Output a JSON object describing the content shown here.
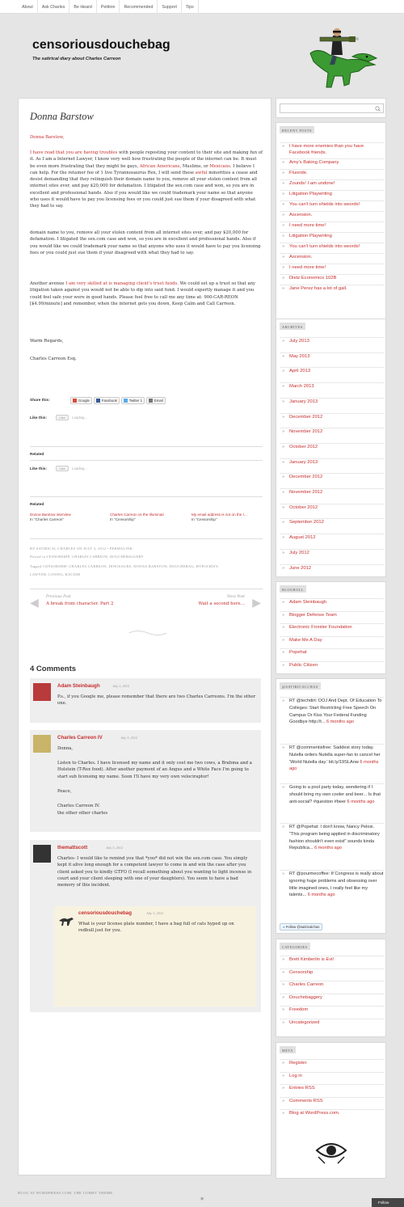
{
  "nav": [
    "About",
    "Ask Charles",
    "Be Heard",
    "Petition",
    "Recommended",
    "Support",
    "Tips"
  ],
  "site": {
    "title": "censoriousdouchebag",
    "tagline": "The satirical diary about Charles Carreon"
  },
  "post": {
    "title": "Donna Barstow",
    "salutation": "Donna Barstow,",
    "p1_link": "I have read that you are having troubles",
    "p1_a": " with people reposting your content to their site and making fun of it. As I am a Internet Lawyer, I know very well how frustrating the people of the internet can be. It must be even more frustrating that they might be gays, ",
    "p1_aa": "African Americans",
    "p1_b": ", Muslims, or ",
    "p1_mex": "Mexicans",
    "p1_c": ". I believe I can help. For the retainer fee of 1 live Tyrannosaurus Rex, I will send these ",
    "p1_awful": "awful",
    "p1_d": " minorities a cease and desist demanding that they relinquish their domain name to you, remove all your stolen content from all internet sites ever, and pay $20,000 for defamation. I litigated the sex.com case and won, so you are in excellent and professional hands. Also if you would like we could trademark your name so that anyone who uses it would have to pay you licensing fees or you could just sue them if your disagreed with what they had to say.",
    "p2": "domain name to you, remove all your stolen content from all internet sites ever, and pay $20,000 for defamation. I litigated the sex.com case and won, so you are in excellent and professional hands. Also if you would like we could trademark your name so that anyone who uses it would have to pay you licensing fees or you could just sue them if your disagreed with what they had to say.",
    "p3_a": "Another avenue ",
    "p3_link": "I am very skilled at is managing client's trust funds",
    "p3_b": ". We could set up a trust so that any litigation taken against you would not be able to dip into said fund. I would expertly manage it and you could feel safe your were in good hands. Please feel free to call me any time at: 900-CAR-REON [$4.99/minute] and remember, when the internet gets you down, Keep Calm and Call Carreon.",
    "regards": "Warm Regards,",
    "sign": "Charles Carreon Esq."
  },
  "share": {
    "label": "Share this:",
    "buttons": [
      "Google",
      "Facebook",
      "Twitter",
      "Email"
    ],
    "twitter_count": "1"
  },
  "like": {
    "label": "Like this:",
    "button": "Like",
    "loading": "Loading..."
  },
  "related": {
    "label": "Related",
    "items": [
      {
        "title": "Donna Barstow interview",
        "cat": "In \"Charles Carreon\""
      },
      {
        "title": "Charles Carreon vs the Illuminati",
        "cat": "In \"Censorship\""
      },
      {
        "title": "My email address is not on the l…",
        "cat": "In \"Censorship\""
      }
    ]
  },
  "meta": {
    "line1": "BY SATIRICAL CHARLES ON JULY 3, 2012 • PERMALINK",
    "line2": "Posted in CENSORSHIP, CHARLES CARREON, DOUCHEBAGGERY",
    "line3": "Tagged CENSORSHIP, CHARLES CARREON, DINOSAURS, DONNA BARSTOW, DOUCHEBAG, HYPOCRISY,",
    "line4": "LAWYER, LOSING, RACISM"
  },
  "postnav": {
    "prev_label": "Previous Post",
    "prev_title": "A break from character. Part 2",
    "next_label": "Next Post",
    "next_title": "Wait a second here…"
  },
  "comments": {
    "title": "4 Comments",
    "list": [
      {
        "author": "Adam Steinbaugh",
        "date": "July 3, 2012",
        "text": "P.s., if you Google me, please remember that there are two Charles Carreons. I'm the other one."
      },
      {
        "author": "Charles Carreon IV",
        "date": "July 3, 2012",
        "t1": "Donna,",
        "t2": "Listen to Charles. I have licensed my name and it only cost me two cows, a Brahma and a Holstein (T-Rex food). After another payment of an Angus and a White Face I'm going to start sub licensing my name. Soon I'll have my very own velociraptor!",
        "t3": "Peace,",
        "t4": "Charles Carreon IV.",
        "t5": "the other other charles"
      },
      {
        "author": "themattscott",
        "date": "July 3, 2012",
        "text": "Charles- I would like to remind you that *you* did not win the sex.com case. You simply kept it alive long enough for a competent lawyer to come in and win the case after you client asked you to kindly GTFO (I recall something about you wanting to light incense in court and your client sleeping with one of your daughters). You seem to have a bad memory of this incident."
      },
      {
        "author": "censoriousdouchebag",
        "date": "July 3, 2012",
        "text": "What is your license plate number, I have a bag full of cats hyped up on redbull just for you."
      }
    ]
  },
  "sidebar": {
    "recent_title": "RECENT POSTS",
    "recent": [
      "I have more enemies than you have Facebook friends.",
      "Amy's Baking Company",
      "Fluoride.",
      "Zounds! I am undone!",
      "Litigation Playwriting",
      "You can't turn shields into swords!",
      "Ascension.",
      "I need more time!",
      "Litigation Playwriting",
      "You can't turn shields into swords!",
      "Ascension.",
      "I need more time!",
      "Dietz Economics 102B",
      "Jane Perez has a lot of gall."
    ],
    "archives_title": "ARCHIVES",
    "archives": [
      "July 2013",
      "May 2013",
      "April 2013",
      "March 2013",
      "January 2013",
      "December 2012",
      "November 2012",
      "October 2012",
      "January 2013",
      "December 2012",
      "November 2012",
      "October 2012",
      "September 2012",
      "August 2012",
      "July 2012",
      "June 2012"
    ],
    "blogroll_title": "BLOGROLL",
    "blogroll": [
      "Adam Steinbaugh",
      "Blogger Defense Team",
      "Electronic Frontier Foundation",
      "Make Me A Day",
      "Popehat",
      "Public Citizen"
    ],
    "twitter_title": "@SATIRICALCHAS",
    "tweets": [
      {
        "text": "RT @techdirt: DOJ And Dept. Of Education To Colleges: Start Restricting Free Speech On Campus Or Kiss Your Federal Funding Goodbye http://t...",
        "time": "6 months ago"
      },
      {
        "text": "RT @commentisfree: Saddest story today. Nutella orders Nutella super-fan to cancel her 'World Nutella day.' bit.ly/19SLAnw",
        "time": "6 months ago"
      },
      {
        "text": "Going to a pool party today, wondering if I should bring my own cooler and beer... Is that anti-social? #question #beer",
        "time": "6 months ago"
      },
      {
        "text": "RT @Popehat: I don't know, Nancy Pelosi. \"This program being applied in discriminatory fashion shouldn't even exist\" sounds kinda Republica...",
        "time": "6 months ago"
      },
      {
        "text": "RT @pourmecoffee: If Congress is really about ignoring huge problems and obsessing over little imagined ones, I really feel like my talents...",
        "time": "6 months ago"
      }
    ],
    "follow_twitter": "Follow @satiricalchas",
    "categories_title": "CATEGORIES",
    "categories": [
      "Brett Kimberlin is Evil",
      "Censorship",
      "Charles Carreon",
      "Douchebaggery",
      "Freedom",
      "Uncategorized"
    ],
    "meta_title": "META",
    "meta": [
      "Register",
      "Log in",
      "Entries RSS",
      "Comments RSS",
      "Blog at WordPress.com."
    ]
  },
  "footer": "BLOG AT WORDPRESS.COM. THE COMET THEME.",
  "follow_button": "Follow",
  "colors": {
    "link": "#c62d2d",
    "background": "#e5e5e5",
    "dino": "#2f8a2a"
  }
}
